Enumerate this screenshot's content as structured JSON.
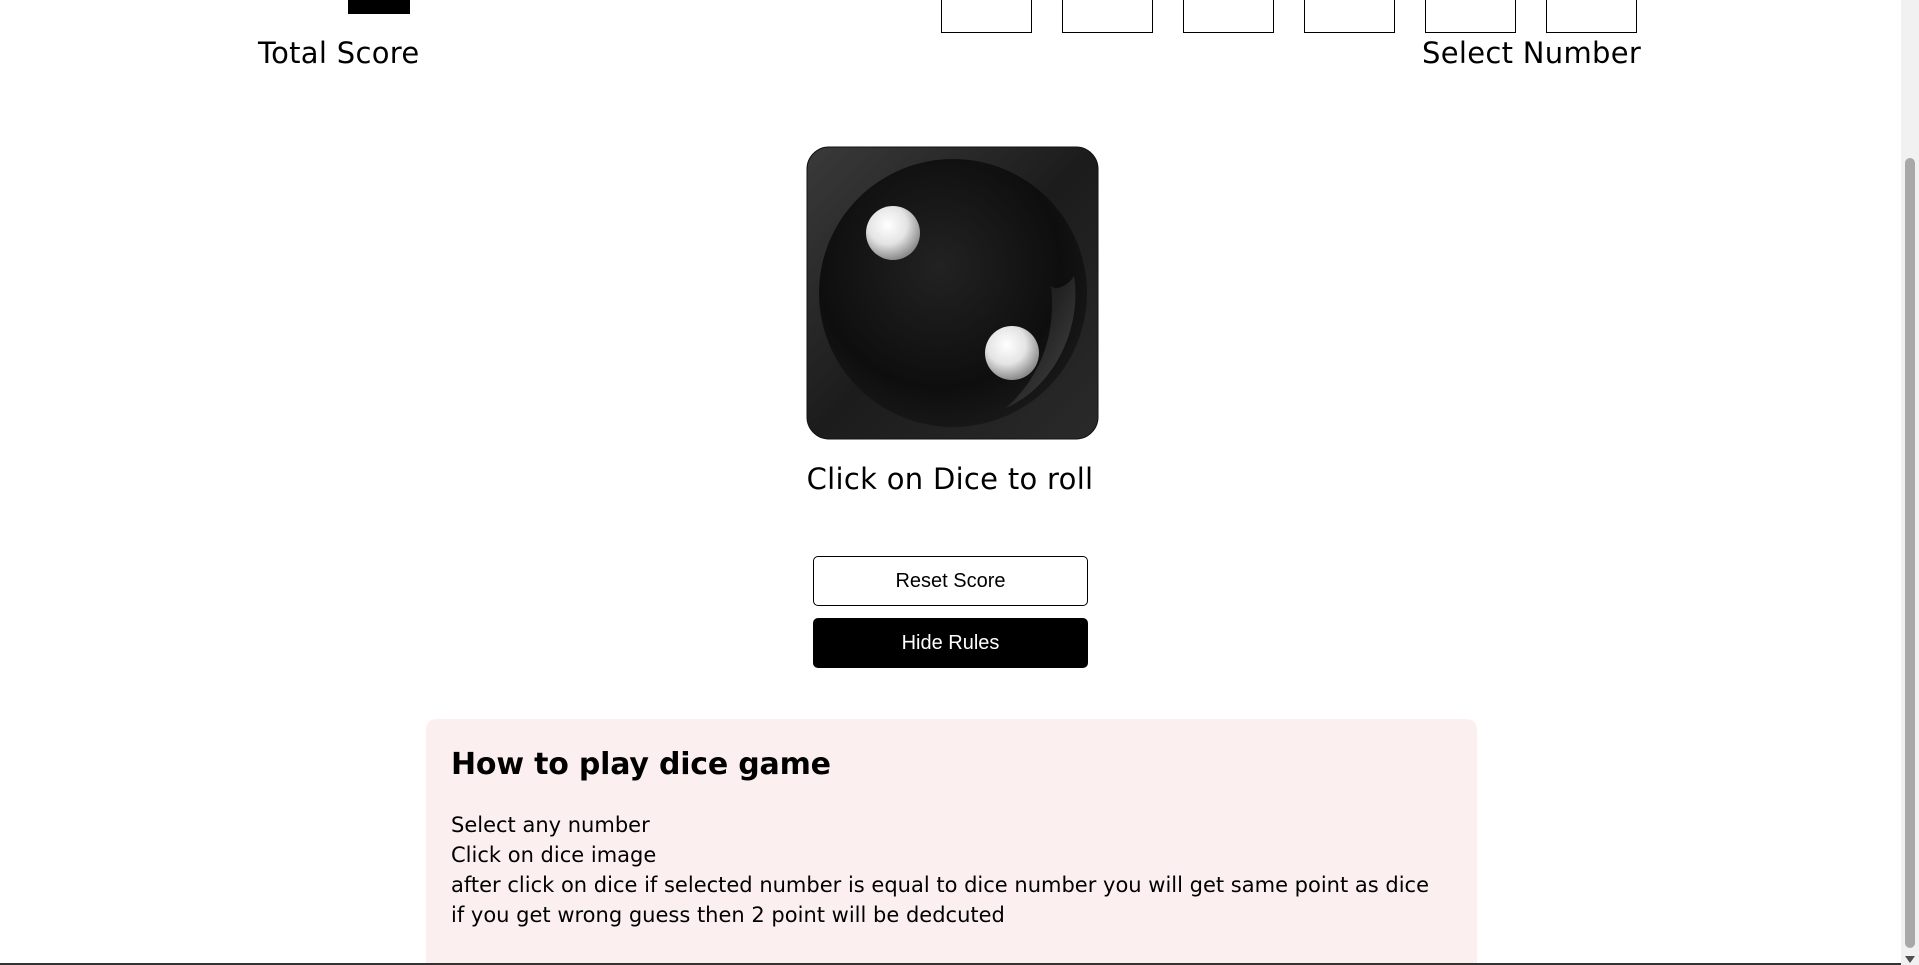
{
  "scoreboard": {
    "total_score_label": "Total Score",
    "select_number_label": "Select Number",
    "number_boxes": [
      "",
      "",
      "",
      "",
      "",
      ""
    ]
  },
  "dice": {
    "face_value": 2,
    "icon": "dice-face-2-icon"
  },
  "roll_hint": "Click on Dice to roll",
  "buttons": {
    "reset_label": "Reset Score",
    "rules_label": "Hide Rules"
  },
  "rules": {
    "title": "How to play dice game",
    "lines": [
      "Select any number",
      "Click on dice image",
      "after click on dice if selected number is equal to dice number you will get same point as dice",
      "if you get wrong guess then 2 point will be dedcuted"
    ]
  },
  "colors": {
    "rules_background": "#fbf0ef",
    "primary": "#000000",
    "background": "#ffffff"
  }
}
